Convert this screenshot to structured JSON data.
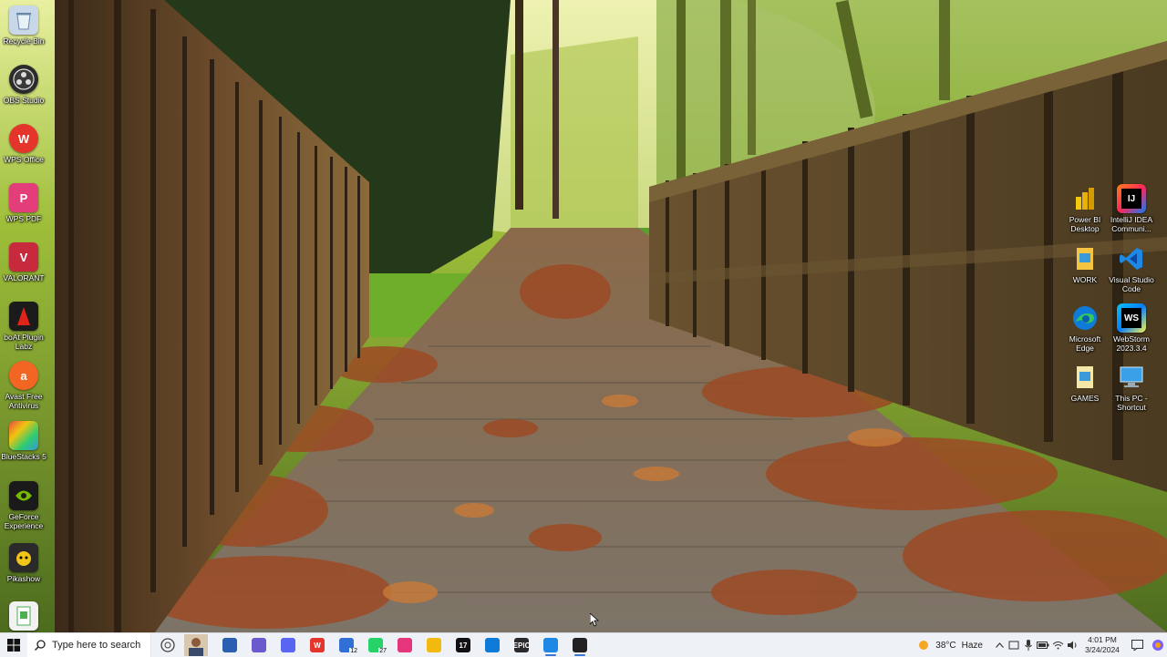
{
  "desktop": {
    "left_icons": [
      {
        "name": "recycle-bin",
        "label": "Recycle Bin",
        "icon": "recycle-bin-icon",
        "color": "#9bb7d4"
      },
      {
        "name": "obs-studio",
        "label": "OBS Studio",
        "icon": "obs-icon",
        "color": "#2b2b2b"
      },
      {
        "name": "wps-office",
        "label": "WPS Office",
        "icon": "wps-office-icon",
        "color": "#e5352b"
      },
      {
        "name": "wps-pdf",
        "label": "WPS PDF",
        "icon": "wps-pdf-icon",
        "color": "#e33d7a"
      },
      {
        "name": "valorant",
        "label": "VALORANT",
        "icon": "valorant-icon",
        "color": "#c62a3c"
      },
      {
        "name": "boat-plugin-labz",
        "label": "boAt Plugin Labz",
        "icon": "boat-icon",
        "color": "#1b1b1b"
      },
      {
        "name": "avast",
        "label": "Avast Free Antivirus",
        "icon": "avast-icon",
        "color": "#f26522"
      },
      {
        "name": "bluestacks",
        "label": "BlueStacks 5",
        "icon": "bluestacks-icon",
        "color": "#4a9a3a"
      },
      {
        "name": "geforce",
        "label": "GeForce Experience",
        "icon": "geforce-icon",
        "color": "#76b900"
      },
      {
        "name": "pikashow",
        "label": "Pikashow",
        "icon": "pikashow-icon",
        "color": "#f0c419"
      },
      {
        "name": "file",
        "label": "",
        "icon": "file-icon",
        "color": "#4caf50"
      }
    ],
    "right_icons": [
      {
        "name": "powerbi",
        "label": "Power BI Desktop",
        "icon": "powerbi-icon",
        "color": "#f2c811"
      },
      {
        "name": "intellij",
        "label": "IntelliJ IDEA Communi...",
        "icon": "intellij-icon",
        "color": "#000000",
        "text": "IJ"
      },
      {
        "name": "work-folder",
        "label": "WORK",
        "icon": "folder-icon",
        "color": "#f5c542"
      },
      {
        "name": "vscode",
        "label": "Visual Studio Code",
        "icon": "vscode-icon",
        "color": "#1e88e5"
      },
      {
        "name": "edge",
        "label": "Microsoft Edge",
        "icon": "edge-icon",
        "color": "#0f7bd8"
      },
      {
        "name": "webstorm",
        "label": "WebStorm 2023.3.4",
        "icon": "webstorm-icon",
        "color": "#07c3f2",
        "text": "WS"
      },
      {
        "name": "games-folder",
        "label": "GAMES",
        "icon": "folder-icon",
        "color": "#f5c542"
      },
      {
        "name": "this-pc",
        "label": "This PC - Shortcut",
        "icon": "computer-icon",
        "color": "#3aa0e8"
      }
    ]
  },
  "taskbar": {
    "search_placeholder": "Type here to search",
    "apps": [
      {
        "name": "task-view",
        "icon": "task-view-icon",
        "color": "#2b5fb0",
        "text": ""
      },
      {
        "name": "copilot",
        "icon": "copilot-icon",
        "color": "#6a5acd",
        "text": ""
      },
      {
        "name": "discord",
        "icon": "discord-icon",
        "color": "#5865f2",
        "text": ""
      },
      {
        "name": "wps",
        "icon": "wps-icon",
        "color": "#e5352b",
        "text": "W"
      },
      {
        "name": "mail",
        "icon": "mail-icon",
        "color": "#2f6fd6",
        "text": "",
        "badge": "12"
      },
      {
        "name": "whatsapp",
        "icon": "whatsapp-icon",
        "color": "#25d366",
        "text": "",
        "badge": "27"
      },
      {
        "name": "calendar",
        "icon": "calendar-icon",
        "color": "#e6357a",
        "text": ""
      },
      {
        "name": "file-explorer",
        "icon": "folder-icon",
        "color": "#f2b90f",
        "text": ""
      },
      {
        "name": "tradingview",
        "icon": "tradingview-icon",
        "color": "#111111",
        "text": "17"
      },
      {
        "name": "edge",
        "icon": "edge-icon",
        "color": "#0f7bd8",
        "text": ""
      },
      {
        "name": "epic-games",
        "icon": "epic-games-icon",
        "color": "#2a2a2a",
        "text": "EPIC"
      },
      {
        "name": "vscode",
        "icon": "vscode-icon",
        "color": "#1e88e5",
        "text": "",
        "active": true
      },
      {
        "name": "obs",
        "icon": "obs-icon",
        "color": "#222222",
        "text": "",
        "active": true
      }
    ],
    "weather": {
      "temp": "38°C",
      "condition": "Haze"
    },
    "clock": {
      "time": "4:01 PM",
      "date": "3/24/2024"
    }
  }
}
